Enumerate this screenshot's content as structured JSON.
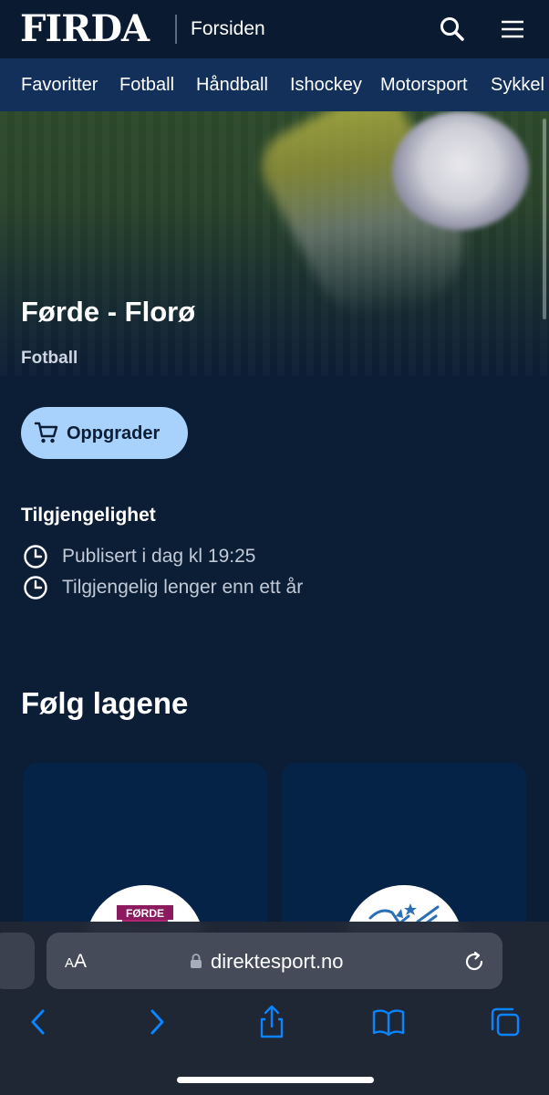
{
  "header": {
    "logo_text": "FIRDA",
    "section_title": "Forsiden",
    "search_icon": "search-icon",
    "menu_icon": "hamburger-menu-icon"
  },
  "nav": {
    "items": [
      "Favoritter",
      "Fotball",
      "Håndball",
      "Ishockey",
      "Motorsport",
      "Sykkel"
    ]
  },
  "match": {
    "title": "Førde - Florø",
    "sport": "Fotball",
    "upgrade_label": "Oppgrader",
    "upgrade_icon": "shopping-cart-icon"
  },
  "availability": {
    "heading": "Tilgjengelighet",
    "rows": [
      {
        "icon": "clock-icon",
        "text": "Publisert i dag kl 19:25"
      },
      {
        "icon": "clock-icon",
        "text": "Tilgjengelig lenger enn ett år"
      }
    ]
  },
  "teams": {
    "heading": "Følg lagene",
    "cards": [
      {
        "logo_text": "FØRDE",
        "logo_color": "#8b1a5e"
      },
      {
        "logo_text": "",
        "logo_color": "#2c6fb5"
      }
    ]
  },
  "browser": {
    "aa_small": "A",
    "aa_big": "A",
    "url": "direktesport.no",
    "lock_icon": "lock-icon",
    "reload_icon": "reload-icon",
    "toolbar": [
      "back-icon",
      "forward-icon",
      "share-icon",
      "bookmarks-icon",
      "tabs-icon"
    ]
  },
  "colors": {
    "background": "#0c1d36",
    "nav_bar": "#13305a",
    "accent_button": "#a8d1fb",
    "card": "#052347",
    "browser_icon": "#0a84ff"
  }
}
